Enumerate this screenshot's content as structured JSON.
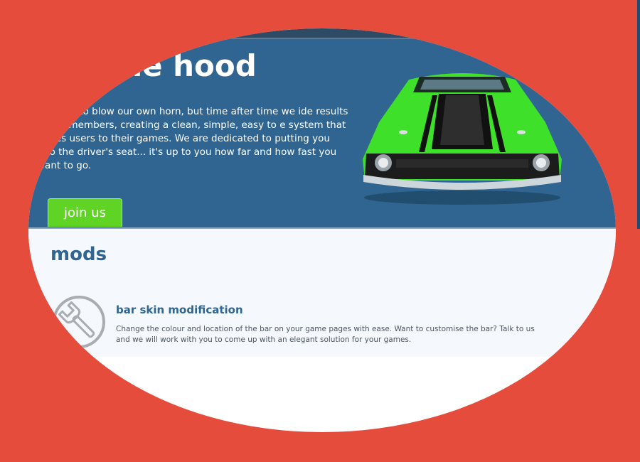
{
  "hero": {
    "title": "the hood",
    "description": "n't want to blow our own horn, but time after time we ide results to our members, creating a clean, simple, easy to e system that drives users to their games. We are dedicated to putting you into the driver's seat... it's up to you how far and how fast you want to go.",
    "join_label": "join us",
    "car_image": "green-muscle-car"
  },
  "mods": {
    "heading": "mods",
    "items": [
      {
        "icon": "wrench-icon",
        "title": "bar skin modification",
        "description": "Change the colour and location of the bar on your game pages with ease. Want to customise the bar? Talk to us and we will work with you to come up with an elegant solution for your games."
      }
    ]
  },
  "colors": {
    "background": "#e64c3c",
    "hero": "#2f6590",
    "accent": "#5fd425",
    "heading": "#2f6590"
  }
}
